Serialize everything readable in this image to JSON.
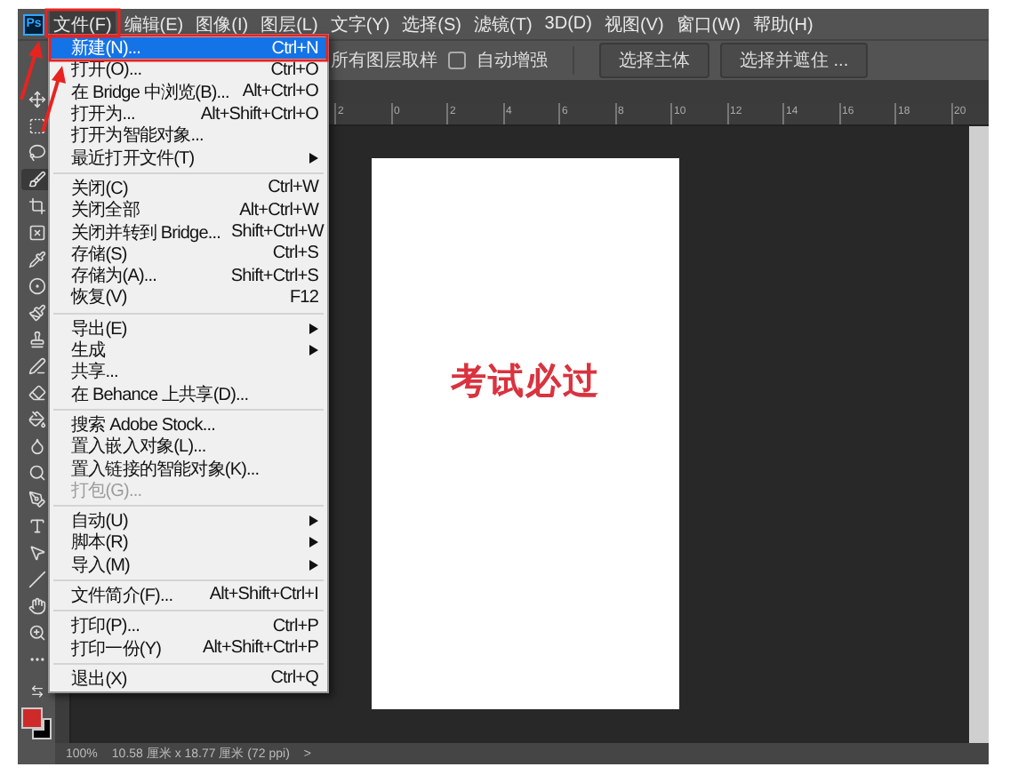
{
  "app": {
    "logo": "Ps"
  },
  "menu_bar": [
    {
      "label": "文件(F)",
      "selected": true
    },
    {
      "label": "编辑(E)",
      "selected": false
    },
    {
      "label": "图像(I)",
      "selected": false
    },
    {
      "label": "图层(L)",
      "selected": false
    },
    {
      "label": "文字(Y)",
      "selected": false
    },
    {
      "label": "选择(S)",
      "selected": false
    },
    {
      "label": "滤镜(T)",
      "selected": false
    },
    {
      "label": "3D(D)",
      "selected": false
    },
    {
      "label": "视图(V)",
      "selected": false
    },
    {
      "label": "窗口(W)",
      "selected": false
    },
    {
      "label": "帮助(H)",
      "selected": false
    }
  ],
  "options_bar": {
    "sample_label": "所有图层取样",
    "auto_enhance": {
      "label": "自动增强",
      "checked": false
    },
    "buttons": [
      "选择主体",
      "选择并遮住 ..."
    ]
  },
  "ruler": {
    "ticks": [
      "2",
      "0",
      "2",
      "4",
      "6",
      "8",
      "10",
      "12",
      "14",
      "16",
      "18",
      "20"
    ]
  },
  "tools": [
    {
      "selected": false
    },
    {
      "selected": false
    },
    {
      "selected": false
    },
    {
      "selected": true
    },
    {
      "selected": false
    },
    {
      "selected": false
    },
    {
      "selected": false
    },
    {
      "selected": false
    },
    {
      "selected": false
    },
    {
      "selected": false
    },
    {
      "selected": false
    },
    {
      "selected": false
    },
    {
      "selected": false
    },
    {
      "selected": false
    },
    {
      "selected": false
    },
    {
      "selected": false
    },
    {
      "selected": false
    },
    {
      "selected": false
    },
    {
      "selected": false
    },
    {
      "selected": false
    },
    {
      "selected": false
    },
    {
      "selected": false
    }
  ],
  "colors": [
    {
      "kind": "foreground",
      "color": "#cf2a2a"
    },
    {
      "kind": "background",
      "color": "#000000"
    }
  ],
  "document": {
    "text": "考试必过"
  },
  "status_bar": {
    "zoom": "100%",
    "size": "10.58 厘米 x 18.77 厘米 (72 ppi)",
    "arrow": ">"
  },
  "file_menu": {
    "sections": [
      [
        {
          "label": "新建(N)...",
          "shortcut": "Ctrl+N",
          "submenu": false,
          "disabled": false,
          "selected": true
        },
        {
          "label": "打开(O)...",
          "shortcut": "Ctrl+O",
          "submenu": false,
          "disabled": false,
          "selected": false
        },
        {
          "label": "在 Bridge 中浏览(B)...",
          "shortcut": "Alt+Ctrl+O",
          "submenu": false,
          "disabled": false,
          "selected": false
        },
        {
          "label": "打开为...",
          "shortcut": "Alt+Shift+Ctrl+O",
          "submenu": false,
          "disabled": false,
          "selected": false
        },
        {
          "label": "打开为智能对象...",
          "submenu": false,
          "disabled": false,
          "selected": false
        },
        {
          "label": "最近打开文件(T)",
          "submenu": true,
          "disabled": false,
          "selected": false
        }
      ],
      [
        {
          "label": "关闭(C)",
          "shortcut": "Ctrl+W",
          "submenu": false,
          "disabled": false,
          "selected": false
        },
        {
          "label": "关闭全部",
          "shortcut": "Alt+Ctrl+W",
          "submenu": false,
          "disabled": false,
          "selected": false
        },
        {
          "label": "关闭并转到 Bridge...",
          "shortcut": "Shift+Ctrl+W",
          "submenu": false,
          "disabled": false,
          "selected": false
        },
        {
          "label": "存储(S)",
          "shortcut": "Ctrl+S",
          "submenu": false,
          "disabled": false,
          "selected": false
        },
        {
          "label": "存储为(A)...",
          "shortcut": "Shift+Ctrl+S",
          "submenu": false,
          "disabled": false,
          "selected": false
        },
        {
          "label": "恢复(V)",
          "shortcut": "F12",
          "submenu": false,
          "disabled": false,
          "selected": false
        }
      ],
      [
        {
          "label": "导出(E)",
          "submenu": true,
          "disabled": false,
          "selected": false
        },
        {
          "label": "生成",
          "submenu": true,
          "disabled": false,
          "selected": false
        },
        {
          "label": "共享...",
          "submenu": false,
          "disabled": false,
          "selected": false
        },
        {
          "label": "在 Behance 上共享(D)...",
          "submenu": false,
          "disabled": false,
          "selected": false
        }
      ],
      [
        {
          "label": "搜索 Adobe Stock...",
          "submenu": false,
          "disabled": false,
          "selected": false
        },
        {
          "label": "置入嵌入对象(L)...",
          "submenu": false,
          "disabled": false,
          "selected": false
        },
        {
          "label": "置入链接的智能对象(K)...",
          "submenu": false,
          "disabled": false,
          "selected": false
        },
        {
          "label": "打包(G)...",
          "submenu": false,
          "disabled": true,
          "selected": false
        }
      ],
      [
        {
          "label": "自动(U)",
          "submenu": true,
          "disabled": false,
          "selected": false
        },
        {
          "label": "脚本(R)",
          "submenu": true,
          "disabled": false,
          "selected": false
        },
        {
          "label": "导入(M)",
          "submenu": true,
          "disabled": false,
          "selected": false
        }
      ],
      [
        {
          "label": "文件简介(F)...",
          "shortcut": "Alt+Shift+Ctrl+I",
          "submenu": false,
          "disabled": false,
          "selected": false
        }
      ],
      [
        {
          "label": "打印(P)...",
          "shortcut": "Ctrl+P",
          "submenu": false,
          "disabled": false,
          "selected": false
        },
        {
          "label": "打印一份(Y)",
          "shortcut": "Alt+Shift+Ctrl+P",
          "submenu": false,
          "disabled": false,
          "selected": false
        }
      ],
      [
        {
          "label": "退出(X)",
          "shortcut": "Ctrl+Q",
          "submenu": false,
          "disabled": false,
          "selected": false
        }
      ]
    ]
  }
}
